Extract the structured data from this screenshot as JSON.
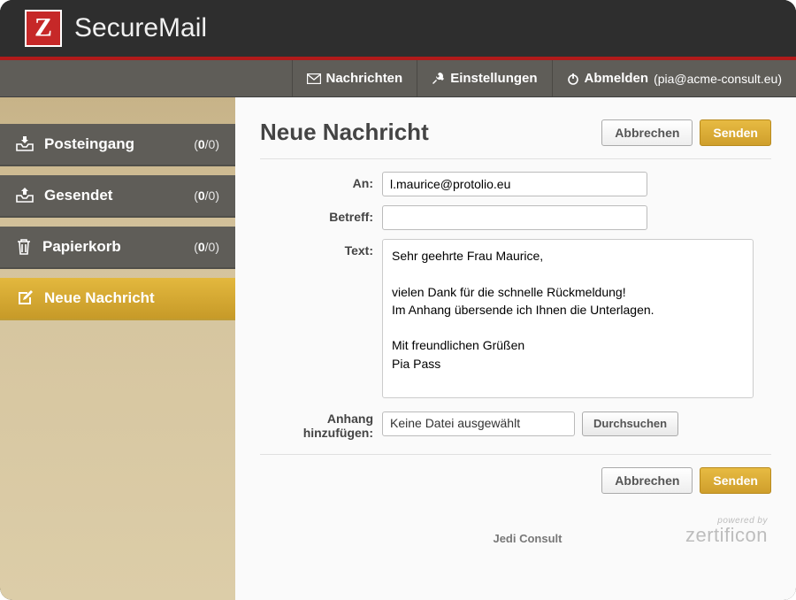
{
  "app": {
    "title": "SecureMail"
  },
  "topnav": {
    "messages": "Nachrichten",
    "settings": "Einstellungen",
    "logout": "Abmelden",
    "user": "(pia@acme-consult.eu)"
  },
  "sidebar": {
    "inbox": {
      "label": "Posteingang",
      "unread": "0",
      "total": "/0)"
    },
    "sent": {
      "label": "Gesendet",
      "unread": "0",
      "total": "/0)"
    },
    "trash": {
      "label": "Papierkorb",
      "unread": "0",
      "total": "/0)"
    },
    "compose": {
      "label": "Neue Nachricht"
    }
  },
  "page": {
    "title": "Neue Nachricht",
    "cancel": "Abbrechen",
    "send": "Senden"
  },
  "form": {
    "to_label": "An:",
    "to_value": "l.maurice@protolio.eu",
    "subject_label": "Betreff:",
    "subject_value": "",
    "body_label": "Text:",
    "body_value": "Sehr geehrte Frau Maurice,\n\nvielen Dank für die schnelle Rückmeldung!\nIm Anhang übersende ich Ihnen die Unterlagen.\n\nMit freundlichen Grüßen\nPia Pass",
    "attach_label": "Anhang hinzufügen:",
    "attach_value": "Keine Datei ausgewählt",
    "browse": "Durchsuchen"
  },
  "footer": {
    "company": "Jedi Consult",
    "powered_by": "powered by",
    "brand": "zertificon"
  }
}
